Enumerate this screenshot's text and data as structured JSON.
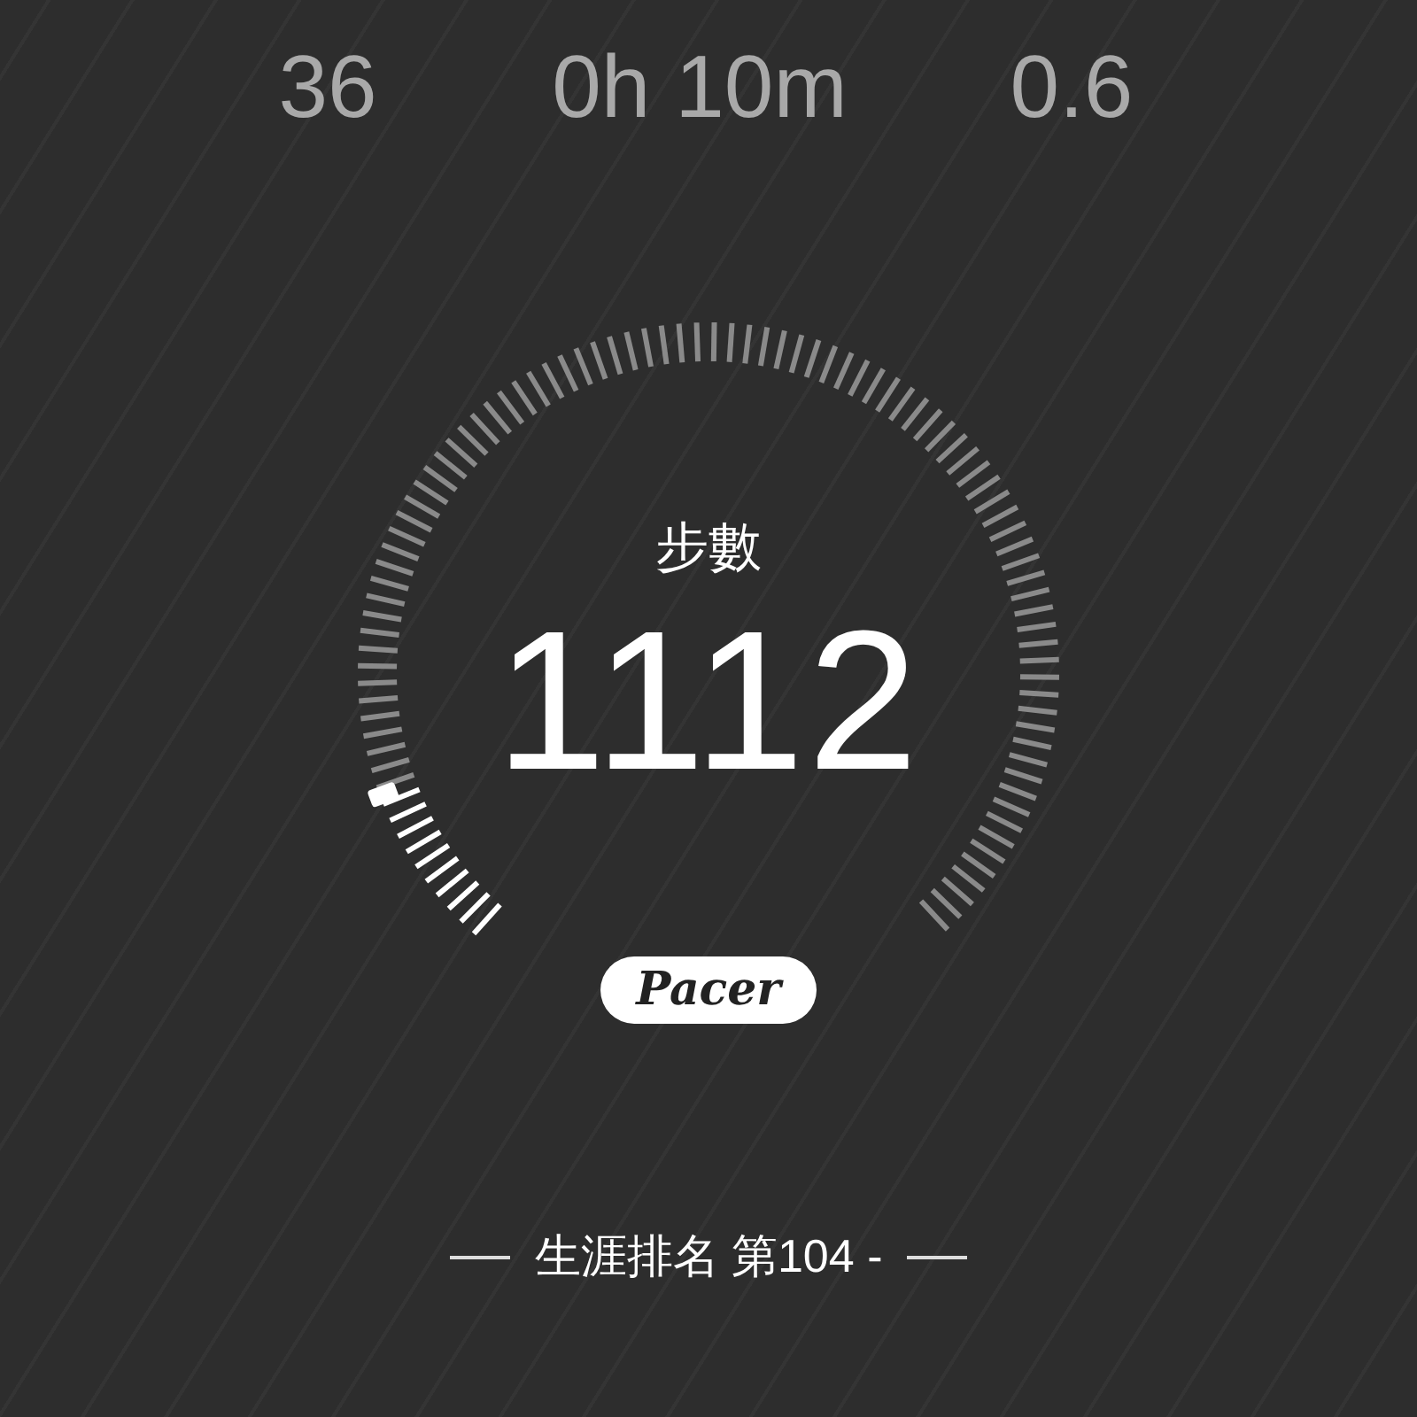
{
  "stats": [
    {
      "value": "36"
    },
    {
      "value": "0h 10m"
    },
    {
      "value": "0.6"
    }
  ],
  "gauge": {
    "label": "步數",
    "value": "1112"
  },
  "logo": {
    "text": "Pacer"
  },
  "rank": {
    "text": "生涯排名 第104 -"
  }
}
